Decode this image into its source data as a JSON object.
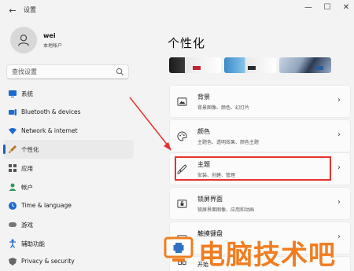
{
  "window": {
    "title": "设置",
    "back": "←",
    "minimize": "—",
    "maximize": "☐",
    "close": "✕"
  },
  "user": {
    "name": "wei",
    "type": "本地帐户"
  },
  "search": {
    "placeholder": "查找设置"
  },
  "nav": [
    {
      "label": "系统",
      "icon": "system-icon",
      "color": "#1d6bd1"
    },
    {
      "label": "Bluetooth & devices",
      "icon": "bluetooth-icon",
      "color": "#1d6bd1"
    },
    {
      "label": "Network & internet",
      "icon": "network-icon",
      "color": "#1d6bd1"
    },
    {
      "label": "个性化",
      "icon": "brush-icon",
      "color": "#c0741d"
    },
    {
      "label": "应用",
      "icon": "apps-icon",
      "color": "#555555"
    },
    {
      "label": "帐户",
      "icon": "account-icon",
      "color": "#2e9a5a"
    },
    {
      "label": "Time & language",
      "icon": "time-icon",
      "color": "#1d6bd1"
    },
    {
      "label": "游戏",
      "icon": "game-icon",
      "color": "#777777"
    },
    {
      "label": "辅助功能",
      "icon": "accessibility-icon",
      "color": "#1d6bd1"
    },
    {
      "label": "Privacy & security",
      "icon": "shield-icon",
      "color": "#666666"
    }
  ],
  "active_nav": "个性化",
  "page": {
    "title": "个性化"
  },
  "cards": [
    {
      "title": "背景",
      "sub": "背景图像、颜色、幻灯片",
      "icon": "image-icon"
    },
    {
      "title": "颜色",
      "sub": "主题色、透明效果、颜色主题",
      "icon": "palette-icon"
    },
    {
      "title": "主题",
      "sub": "安装、创建、管理",
      "icon": "brush-icon"
    },
    {
      "title": "锁屏界面",
      "sub": "锁屏界面图像、应用和动画",
      "icon": "lock-screen-icon"
    },
    {
      "title": "触摸键盘",
      "sub": "",
      "icon": "keyboard-icon"
    },
    {
      "title": "开始",
      "sub": "",
      "icon": "start-icon"
    }
  ],
  "watermark": {
    "text": "电脑技术吧"
  },
  "colors": {
    "accent": "#1d5fb8",
    "highlight": "#e5322f",
    "watermark": "#f07d20"
  }
}
